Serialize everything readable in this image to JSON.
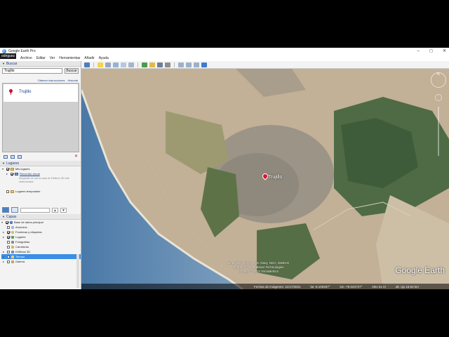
{
  "window": {
    "title": "Google Earth Pro",
    "user_badge": "odriguez",
    "controls": [
      "–",
      "◻",
      "✕"
    ]
  },
  "menu": [
    "Archivo",
    "Editar",
    "Ver",
    "Herramientas",
    "Añadir",
    "Ayuda"
  ],
  "search": {
    "header": "Buscar",
    "value": "Trujillo",
    "button": "Buscar",
    "links": [
      "Obtener instrucciones",
      "Historial"
    ],
    "result_label": "Trujillo"
  },
  "places": {
    "header": "Lugares",
    "items": [
      {
        "label": "Mis lugares",
        "checked": true
      },
      {
        "label": "Recorrido visual",
        "checked": true
      },
      {
        "label": "Asegúrate de que la capa de Edificios 3D esté seleccionada",
        "checked": false
      },
      {
        "label": "Lugares temporales",
        "checked": false
      }
    ]
  },
  "layers": {
    "header": "Capas",
    "items": [
      "Base de datos principal",
      "Anuncios",
      "Fronteras y etiquetas",
      "Lugares",
      "Fotografías",
      "Carreteras",
      "Edificios 3D",
      "Tiempo",
      "Galería"
    ],
    "selected": "Tiempo"
  },
  "map": {
    "city_label": "Trujillo",
    "attribution": [
      "Data SIO, NOAA, U.S. Navy, NGA, GEBCO",
      "Imagen © 2022 Maxar Technologies",
      "Imagen © 2022 TerraMetrics"
    ],
    "brand": "Google Earth",
    "status": [
      "Fechas de imágenes: 11/17/2021",
      "lat  -8.100257°",
      "lon  -79.023727°",
      "elev  51 m",
      "alt. ojo  18.54 km"
    ]
  }
}
